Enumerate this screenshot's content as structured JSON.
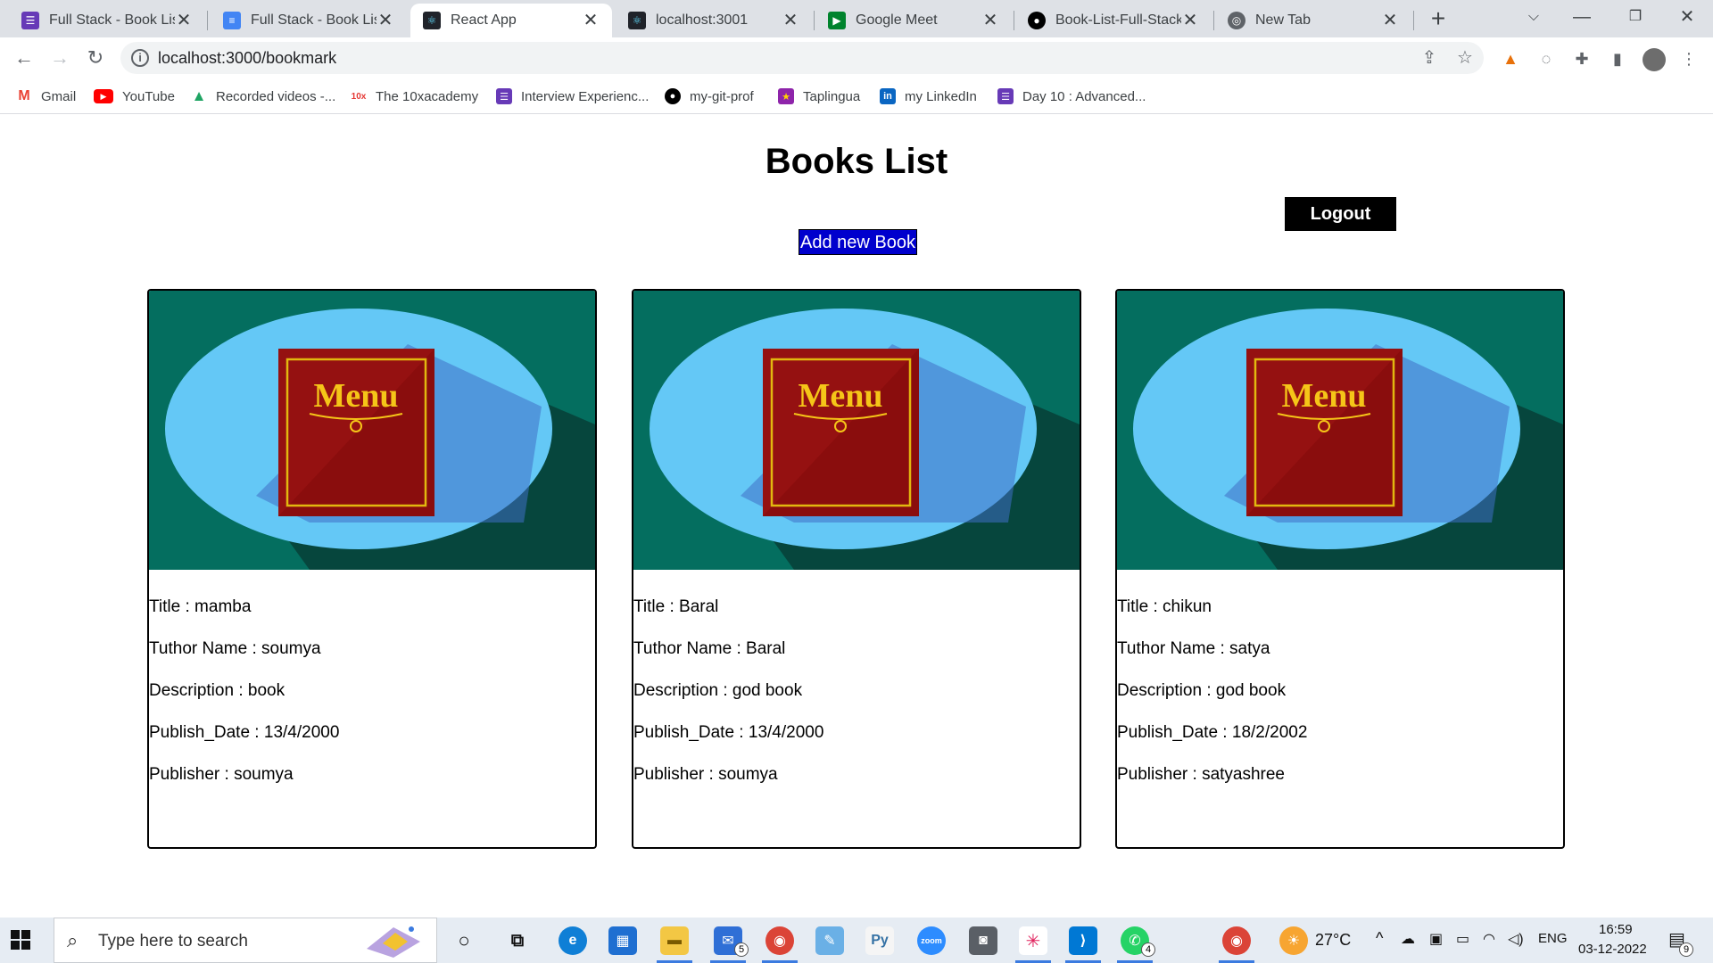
{
  "browser": {
    "tabs": [
      {
        "label": "Full Stack - Book List /",
        "icon": "forms-icon",
        "color": "#673ab7",
        "active": false
      },
      {
        "label": "Full Stack - Book List /",
        "icon": "docs-icon",
        "color": "#4285f4",
        "active": false
      },
      {
        "label": "React App",
        "icon": "react-icon",
        "color": "#20232a",
        "active": true
      },
      {
        "label": "localhost:3001",
        "icon": "react-icon",
        "color": "#20232a",
        "active": false
      },
      {
        "label": "Google Meet",
        "icon": "meet-icon",
        "color": "#00832d",
        "active": false
      },
      {
        "label": "Book-List-Full-Stack/",
        "icon": "github-icon",
        "color": "#000000",
        "active": false
      },
      {
        "label": "New Tab",
        "icon": "globe-icon",
        "color": "#5f6368",
        "active": false
      }
    ],
    "url": "localhost:3000/bookmark",
    "bookmarks": [
      {
        "label": "Gmail",
        "icon": "gmail-icon",
        "color": "#ea4335"
      },
      {
        "label": "YouTube",
        "icon": "youtube-icon",
        "color": "#ff0000"
      },
      {
        "label": "Recorded videos -...",
        "icon": "drive-icon",
        "color": "#1fa463"
      },
      {
        "label": "The 10xacademy",
        "icon": "10x-icon",
        "color": "#e53935"
      },
      {
        "label": "Interview Experienc...",
        "icon": "forms-icon",
        "color": "#673ab7"
      },
      {
        "label": "my-git-prof",
        "icon": "github-icon",
        "color": "#000000"
      },
      {
        "label": "Taplingua",
        "icon": "star-icon",
        "color": "#8e24aa"
      },
      {
        "label": "my LinkedIn",
        "icon": "linkedin-icon",
        "color": "#0a66c2"
      },
      {
        "label": "Day 10 : Advanced...",
        "icon": "forms-icon",
        "color": "#673ab7"
      }
    ]
  },
  "page": {
    "title": "Books List",
    "logout_label": "Logout",
    "add_label": "Add new Book",
    "field_labels": {
      "title": "Title",
      "author": "Tuthor Name",
      "description": "Description",
      "publish_date": "Publish_Date",
      "publisher": "Publisher"
    },
    "image_text": "Menu",
    "books": [
      {
        "title": "mamba",
        "author": "soumya",
        "description": "book",
        "publish_date": "13/4/2000",
        "publisher": "soumya"
      },
      {
        "title": "Baral",
        "author": "Baral",
        "description": "god book",
        "publish_date": "13/4/2000",
        "publisher": "soumya"
      },
      {
        "title": "chikun",
        "author": "satya",
        "description": "god book",
        "publish_date": "18/2/2002",
        "publisher": "satyashree"
      }
    ]
  },
  "taskbar": {
    "search_placeholder": "Type here to search",
    "weather": "27°C",
    "language": "ENG",
    "time": "16:59",
    "date": "03-12-2022",
    "mail_badge": "5",
    "whatsapp_badge": "4",
    "notification_badge": "9"
  }
}
